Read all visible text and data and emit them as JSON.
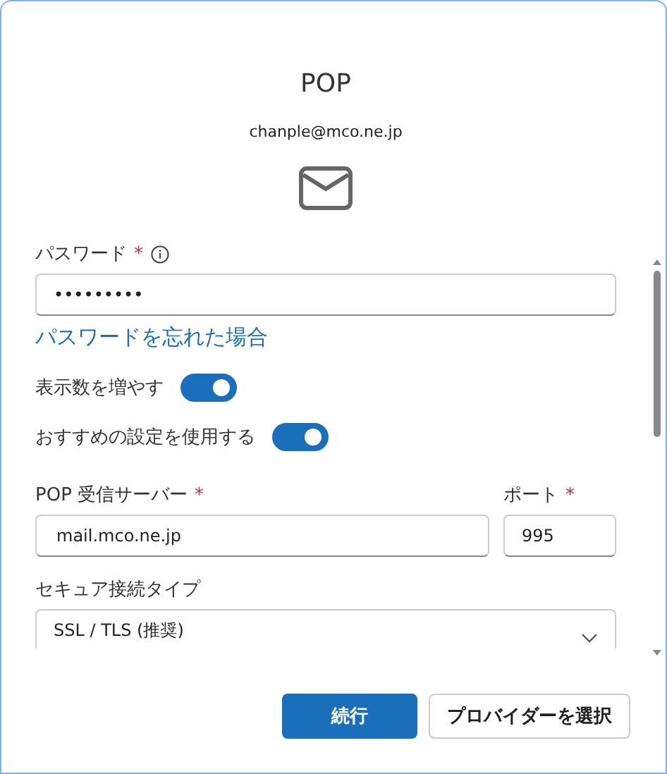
{
  "dialog": {
    "title": "POP",
    "email": "chanple@mco.ne.jp"
  },
  "password": {
    "label": "パスワード",
    "required_mark": "*",
    "value": "•••••••••",
    "forgot_link": "パスワードを忘れた場合"
  },
  "toggles": [
    {
      "label": "表示数を増やす",
      "on": true
    },
    {
      "label": "おすすめの設定を使用する",
      "on": true
    }
  ],
  "server": {
    "label": "POP 受信サーバー",
    "required_mark": "*",
    "value": "mail.mco.ne.jp"
  },
  "port": {
    "label": "ポート",
    "required_mark": "*",
    "value": "995"
  },
  "security": {
    "label": "セキュア接続タイプ",
    "value": "SSL / TLS (推奨)"
  },
  "buttons": [
    {
      "label": "続行",
      "kind": "primary"
    },
    {
      "label": "プロバイダーを選択",
      "kind": "secondary"
    }
  ]
}
